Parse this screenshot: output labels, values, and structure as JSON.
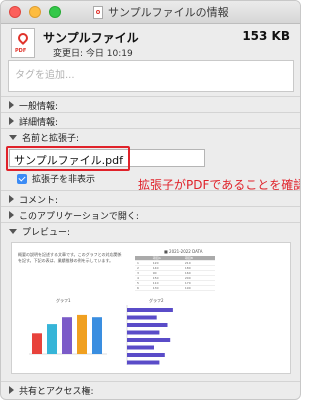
{
  "window": {
    "title": "サンプルファイルの情報"
  },
  "header": {
    "file_name": "サンプルファイル",
    "file_size": "153 KB",
    "modified": "変更日: 今日 10:19",
    "icon_tag": "PDF"
  },
  "tags": {
    "placeholder": "タグを追加..."
  },
  "sections": {
    "general": "一般情報:",
    "more": "詳細情報:",
    "name_ext": "名前と拡張子:",
    "comments": "コメント:",
    "open_with": "このアプリケーションで開く:",
    "preview": "プレビュー:",
    "sharing": "共有とアクセス権:"
  },
  "name_ext": {
    "file_name_value": "サンプルファイル.pdf",
    "hide_extension_label": "拡張子を非表示",
    "hide_extension_checked": true
  },
  "annotation": "拡張子がPDFであることを確認",
  "preview_doc": {
    "intro_text": "概要の説明を記述する文章です。このグラフとの対応関係を記す。下記の表は、業績推移の例を示しています。",
    "table_title": "■ 2021-2022 DATA",
    "table_rows": [
      [
        "",
        "項目A",
        "項目B"
      ],
      [
        "1",
        "120",
        "210"
      ],
      [
        "2",
        "140",
        "180"
      ],
      [
        "3",
        "90",
        "160"
      ],
      [
        "4",
        "150",
        "200"
      ],
      [
        "5",
        "110",
        "170"
      ],
      [
        "6",
        "130",
        "190"
      ]
    ],
    "bar_chart_title": "グラフ1",
    "hbar_chart_title": "グラフ2",
    "bar_values": [
      0.45,
      0.65,
      0.8,
      0.85,
      0.8
    ],
    "bar_colors": [
      "#e8423b",
      "#36b5d8",
      "#7b5bc8",
      "#f0a020",
      "#3a8ee0"
    ],
    "hbar_values": [
      0.85,
      0.55,
      0.75,
      0.6,
      0.8,
      0.5,
      0.7,
      0.6
    ],
    "hbar_color": "#5a4cc8"
  },
  "colors": {
    "highlight": "#e0222a",
    "checkbox": "#3b8bf5"
  }
}
